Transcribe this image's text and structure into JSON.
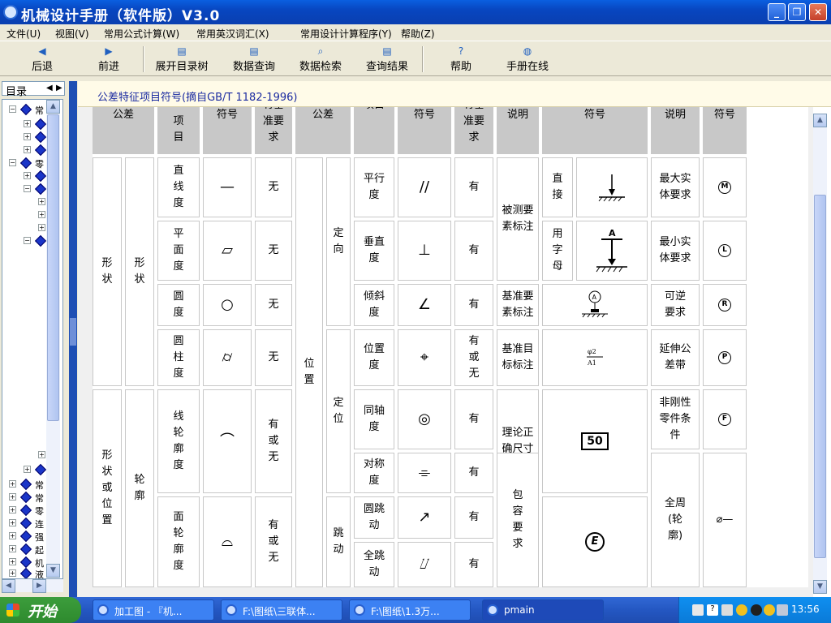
{
  "window": {
    "title": "机械设计手册（软件版）V3.0",
    "min": "_",
    "max": "❐",
    "close": "✕"
  },
  "menu": [
    "文件(U)",
    "视图(V)",
    "常用公式计算(W)",
    "常用英汉词汇(X)",
    "常用设计计算程序(Y)",
    "帮助(Z)"
  ],
  "toolbar": [
    "后退",
    "前进",
    "展开目录树",
    "数据查询",
    "数据检索",
    "查询结果",
    "帮助",
    "手册在线"
  ],
  "sidebar": {
    "tab": "目录",
    "tree_labels": [
      "常",
      "常",
      "零",
      "连",
      "强",
      "起",
      "机",
      "液"
    ]
  },
  "content": {
    "title": "公差特征项目符号(摘自GB/T 1182-1996)"
  },
  "table": {
    "header": [
      "公差",
      "项目",
      "符号",
      "有基准要求",
      "公差",
      "项目",
      "符号",
      "有基准要求",
      "说明",
      "符号",
      "说明",
      "符号"
    ],
    "group1": {
      "main": "形状",
      "sub": "形状"
    },
    "group2": {
      "main": "形状或位置",
      "sub": "轮廓"
    },
    "group3": {
      "main": "位置",
      "sub_dir": "定向",
      "sub_loc": "定位",
      "sub_run": "跳动"
    },
    "left_rows": [
      {
        "item": "直线度",
        "symbol": "—",
        "req": "无"
      },
      {
        "item": "平面度",
        "symbol": "▱",
        "req": "无"
      },
      {
        "item": "圆度",
        "symbol": "○",
        "req": "无"
      },
      {
        "item": "圆柱度",
        "symbol": "⌭",
        "req": "无"
      },
      {
        "item": "线轮廓度",
        "symbol": "⌒",
        "req": "有或无"
      },
      {
        "item": "面轮廓度",
        "symbol": "⌓",
        "req": "有或无"
      }
    ],
    "mid_rows": [
      {
        "item": "平行度",
        "symbol": "//",
        "req": "有"
      },
      {
        "item": "垂直度",
        "symbol": "⊥",
        "req": "有"
      },
      {
        "item": "倾斜度",
        "symbol": "∠",
        "req": "有"
      },
      {
        "item": "位置度",
        "symbol": "⌖",
        "req": "有或无"
      },
      {
        "item": "同轴度",
        "symbol": "◎",
        "req": "有"
      },
      {
        "item": "对称度",
        "symbol": "⌯",
        "req": "有"
      },
      {
        "item": "圆跳动",
        "symbol": "↗",
        "req": "有"
      },
      {
        "item": "全跳动",
        "symbol": "⌰",
        "req": "有"
      }
    ],
    "notes": {
      "measured": "被测要素标注",
      "direct": "直接",
      "byletter": "用字母",
      "datum_feature": "基准要素标注",
      "datum_target": "基准目标标注",
      "datum_target_sym1": "φ2",
      "datum_target_sym2": "A1",
      "theory": "理论正确尺寸",
      "theory_sym": "50",
      "envelope": "包容要求",
      "envelope_sym": "E",
      "letter_A": "A"
    },
    "right_rows": [
      {
        "desc": "最大实体要求",
        "symbol": "M"
      },
      {
        "desc": "最小实体要求",
        "symbol": "L"
      },
      {
        "desc": "可逆要求",
        "symbol": "R"
      },
      {
        "desc": "延伸公差带",
        "symbol": "P"
      },
      {
        "desc": "非刚性零件条件",
        "symbol": "F"
      },
      {
        "desc": "全周(轮廓)",
        "symbol": "⌀—"
      }
    ]
  },
  "taskbar": {
    "start": "开始",
    "tasks": [
      "加工图 - 『机...",
      "F:\\图纸\\三联体...",
      "F:\\图纸\\1.3万...",
      "pmain"
    ],
    "clock": "13:56"
  }
}
